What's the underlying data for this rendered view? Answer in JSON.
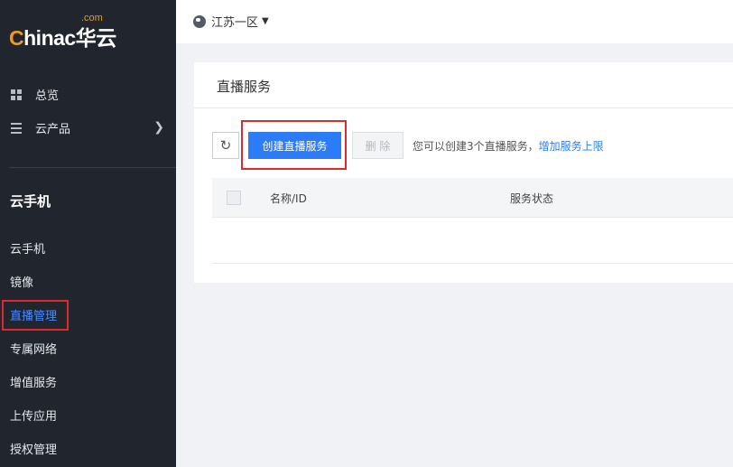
{
  "logo": {
    "com": ".com",
    "brand_prefix": "C",
    "brand_rest": "hinac华云"
  },
  "sidebar": {
    "top_items": [
      {
        "label": "总览",
        "icon": "dashboard-grid-icon"
      },
      {
        "label": "云产品",
        "icon": "menu-lines-icon"
      }
    ],
    "section_title": "云手机",
    "sub_items": [
      {
        "label": "云手机"
      },
      {
        "label": "镜像"
      },
      {
        "label": "直播管理",
        "active": true
      },
      {
        "label": "专属网络"
      },
      {
        "label": "增值服务"
      },
      {
        "label": "上传应用"
      },
      {
        "label": "授权管理"
      }
    ]
  },
  "topbar": {
    "region": "江苏一区",
    "region_icon": "globe-icon"
  },
  "card": {
    "title": "直播服务",
    "refresh_icon": "refresh-icon",
    "create_label": "创建直播服务",
    "delete_label": "删 除",
    "hint_text": "您可以创建3个直播服务，",
    "hint_link": "增加服务上限",
    "columns": {
      "name": "名称/ID",
      "status": "服务状态"
    }
  },
  "colors": {
    "sidebar_bg": "#21252e",
    "accent": "#2b7cf6",
    "highlight": "#e0292b",
    "brand_orange": "#f29a1a"
  }
}
